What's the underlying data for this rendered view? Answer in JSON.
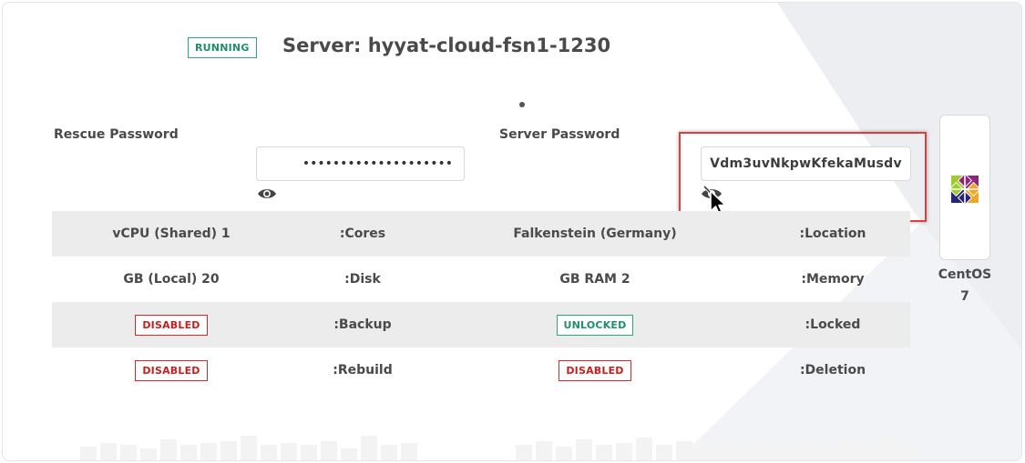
{
  "server": {
    "status": "RUNNING",
    "title": "Server: hyyat-cloud-fsn1-1230"
  },
  "rescue": {
    "label": "Rescue Password",
    "masked_value": "••••••••••••••••••••",
    "eye_icon": "eye-icon"
  },
  "server_password": {
    "label": "Server Password",
    "value": "Vdm3uvNkpwKfekaMusdv",
    "eye_icon": "eye-slash-icon"
  },
  "specs": {
    "rows": [
      {
        "v1": "vCPU (Shared) 1",
        "k1": ":Cores",
        "v2": "Falkenstein (Germany)",
        "k2": ":Location"
      },
      {
        "v1": "GB (Local) 20",
        "k1": ":Disk",
        "v2": "GB RAM 2",
        "k2": ":Memory"
      },
      {
        "v1": "DISABLED",
        "k1": ":Backup",
        "v2": "UNLOCKED",
        "k2": ":Locked"
      },
      {
        "v1": "DISABLED",
        "k1": ":Rebuild",
        "v2": "DISABLED",
        "k2": ":Deletion"
      }
    ]
  },
  "os": {
    "name_line1": "CentOS",
    "name_line2": "7",
    "icon": "centos-logo"
  },
  "colors": {
    "running_green": "#2aa77c",
    "disabled_red": "#d02a2a",
    "highlight_red": "#d9413f",
    "row_shade": "#ececec"
  }
}
